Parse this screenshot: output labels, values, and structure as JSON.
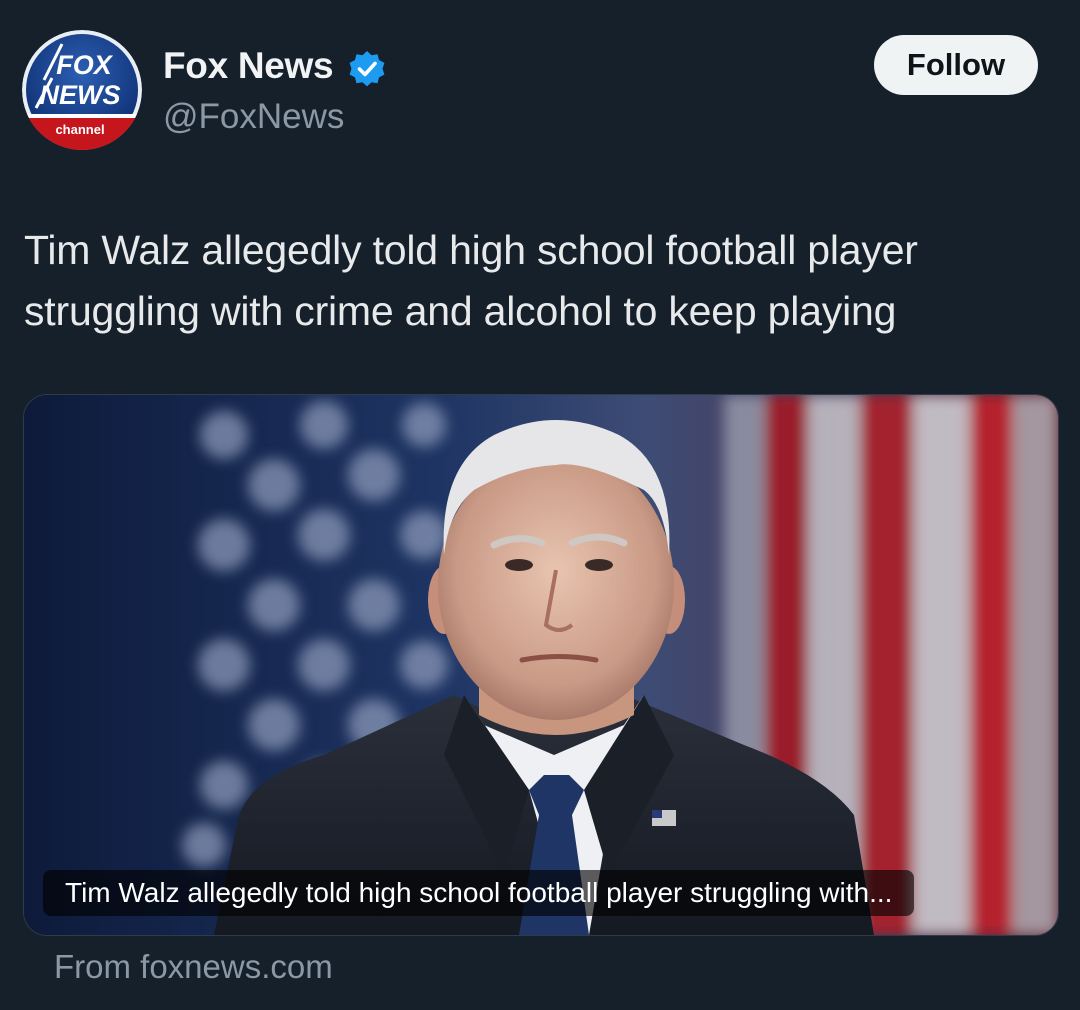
{
  "author": {
    "name": "Fox News",
    "handle": "@FoxNews",
    "verified": true,
    "avatar_icon": "fox-news-channel-logo",
    "logo_text": {
      "line1": "FOX",
      "line2": "NEWS",
      "line3": "channel"
    }
  },
  "follow_button": {
    "label": "Follow"
  },
  "tweet": {
    "text": "Tim Walz allegedly told high school football player struggling with crime and alcohol to keep playing"
  },
  "card": {
    "caption": "Tim Walz allegedly told high school football player struggling with...",
    "source": "From foxnews.com"
  },
  "colors": {
    "background": "#16202b",
    "verified_badge": "#1d9bf0",
    "follow_button_bg": "#eff3f4",
    "secondary_text": "#8b98a5"
  }
}
